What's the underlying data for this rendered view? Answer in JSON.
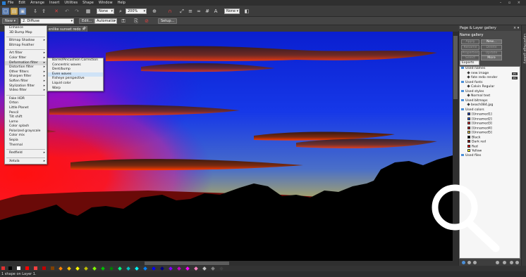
{
  "menubar": {
    "items": [
      "File",
      "Edit",
      "Arrange",
      "Insert",
      "Utilities",
      "Shape",
      "Window",
      "Help"
    ]
  },
  "toolbar": {
    "style_combo": "None",
    "zoom_combo": "200%",
    "quality_combo": "None"
  },
  "infobar": {
    "new_button": "New ▾",
    "effect_combo": "2. Diffuse",
    "edit_button": "Edit...",
    "mode_combo": "Automatic",
    "setup_button": "Setup..."
  },
  "tabs": {
    "document": "...enlike sunset redo"
  },
  "effects_menu": [
    {
      "label": "Enhance",
      "sub": false
    },
    {
      "label": "3D Bump Map",
      "sub": false
    },
    {
      "sep": true
    },
    {
      "label": "Bitmap Shadow",
      "sub": true
    },
    {
      "label": "Bitmap Feather",
      "sub": false
    },
    {
      "sep": true
    },
    {
      "label": "Art filter",
      "sub": true
    },
    {
      "label": "Color filter",
      "sub": true
    },
    {
      "label": "Deformation filter",
      "sub": true,
      "hl": true
    },
    {
      "label": "Distortion filter",
      "sub": true
    },
    {
      "label": "Other filters",
      "sub": true
    },
    {
      "label": "Sharpen filter",
      "sub": true
    },
    {
      "label": "Soften filter",
      "sub": true
    },
    {
      "label": "Stylization filter",
      "sub": true
    },
    {
      "label": "Video filter",
      "sub": true
    },
    {
      "sep": true
    },
    {
      "label": "Fake HDR",
      "sub": false
    },
    {
      "label": "Orton",
      "sub": false
    },
    {
      "label": "Little Planet",
      "sub": false
    },
    {
      "label": "Pencil",
      "sub": false
    },
    {
      "label": "Tilt shift",
      "sub": false
    },
    {
      "label": "Lomo",
      "sub": false
    },
    {
      "label": "Color splash",
      "sub": false
    },
    {
      "label": "Polarized grayscale",
      "sub": false
    },
    {
      "label": "Color mix",
      "sub": false
    },
    {
      "label": "Sepia",
      "sub": false
    },
    {
      "label": "Thermal",
      "sub": false
    },
    {
      "sep": true
    },
    {
      "label": "Redfield",
      "sub": true
    },
    {
      "sep": true
    },
    {
      "label": "Xetula",
      "sub": true
    }
  ],
  "deformation_menu": [
    {
      "label": "Barrel/Pincushion Correction",
      "hl": false
    },
    {
      "label": "Concentric waves",
      "hl": false
    },
    {
      "label": "Dent/bump",
      "hl": false
    },
    {
      "label": "Even waves",
      "hl": true
    },
    {
      "label": "Fisheye perspective",
      "hl": false
    },
    {
      "label": "Liquid color",
      "hl": false
    },
    {
      "label": "Warp",
      "hl": false
    }
  ],
  "panel": {
    "title": "Page & Layer gallery",
    "side_title": "Layer/Page gallery",
    "gallery_label": "Name gallery",
    "buttons": [
      {
        "label": "Apply",
        "disabled": true
      },
      {
        "label": "New...",
        "disabled": false
      },
      {
        "label": "Rename",
        "disabled": true
      },
      {
        "label": "Delete",
        "disabled": true
      },
      {
        "label": "Properties",
        "disabled": true
      },
      {
        "label": "Update",
        "disabled": true
      },
      {
        "label": "Select",
        "disabled": true
      },
      {
        "label": "More",
        "disabled": false
      }
    ],
    "exports_combo": "Exports",
    "tree": [
      {
        "label": "Used names",
        "level": 0,
        "kind": "folder"
      },
      {
        "label": "new image",
        "level": 1,
        "kind": "item",
        "badge": "JPG"
      },
      {
        "label": "fate redo render",
        "level": 1,
        "kind": "item",
        "badge": "JPG"
      },
      {
        "label": "Used fonts",
        "level": 0,
        "kind": "folder"
      },
      {
        "label": "Calvin Regular",
        "level": 1,
        "kind": "item"
      },
      {
        "label": "Used styles",
        "level": 0,
        "kind": "folder"
      },
      {
        "label": "Normal text",
        "level": 1,
        "kind": "item"
      },
      {
        "label": "Used bitmaps",
        "level": 0,
        "kind": "folder"
      },
      {
        "label": "beach084.jpg",
        "level": 1,
        "kind": "item"
      },
      {
        "label": "Used colors",
        "level": 0,
        "kind": "folder"
      },
      {
        "label": "[Unnamed1]",
        "level": 1,
        "kind": "color",
        "color": "#1a3fbf"
      },
      {
        "label": "[Unnamed2]",
        "level": 1,
        "kind": "color",
        "color": "#2d5fd8"
      },
      {
        "label": "[Unnamed3]",
        "level": 1,
        "kind": "color",
        "color": "#d62020"
      },
      {
        "label": "[Unnamed4]",
        "level": 1,
        "kind": "color",
        "color": "#b51515"
      },
      {
        "label": "[Unnamed5]",
        "level": 1,
        "kind": "color",
        "color": "#e0c040"
      },
      {
        "label": "Black",
        "level": 1,
        "kind": "color",
        "color": "#000000"
      },
      {
        "label": "Dark red",
        "level": 1,
        "kind": "color",
        "color": "#8b0000"
      },
      {
        "label": "Red",
        "level": 1,
        "kind": "color",
        "color": "#ff0000"
      },
      {
        "label": "Yellow",
        "level": 1,
        "kind": "color",
        "color": "#ffff00"
      },
      {
        "label": "Used files",
        "level": 0,
        "kind": "folder"
      }
    ]
  },
  "palette": {
    "colors": [
      "#000000",
      "#ffffff",
      "#ff0000",
      "#ff4040",
      "#c00000",
      "#804000",
      "#ff8000",
      "#ffc000",
      "#ffff00",
      "#c0c000",
      "#80ff00",
      "#00c000",
      "#008000",
      "#00ff80",
      "#00c0c0",
      "#00ffff",
      "#0080ff",
      "#0000ff",
      "#000080",
      "#8000ff",
      "#c000c0",
      "#ff00ff",
      "#ff80c0",
      "#c0c0c0",
      "#808080",
      "#404040"
    ]
  },
  "status": {
    "text": "1 shape on Layer 1."
  },
  "colors": {
    "accent": "#4b8fd8",
    "highlight": "#cfe3f7"
  }
}
